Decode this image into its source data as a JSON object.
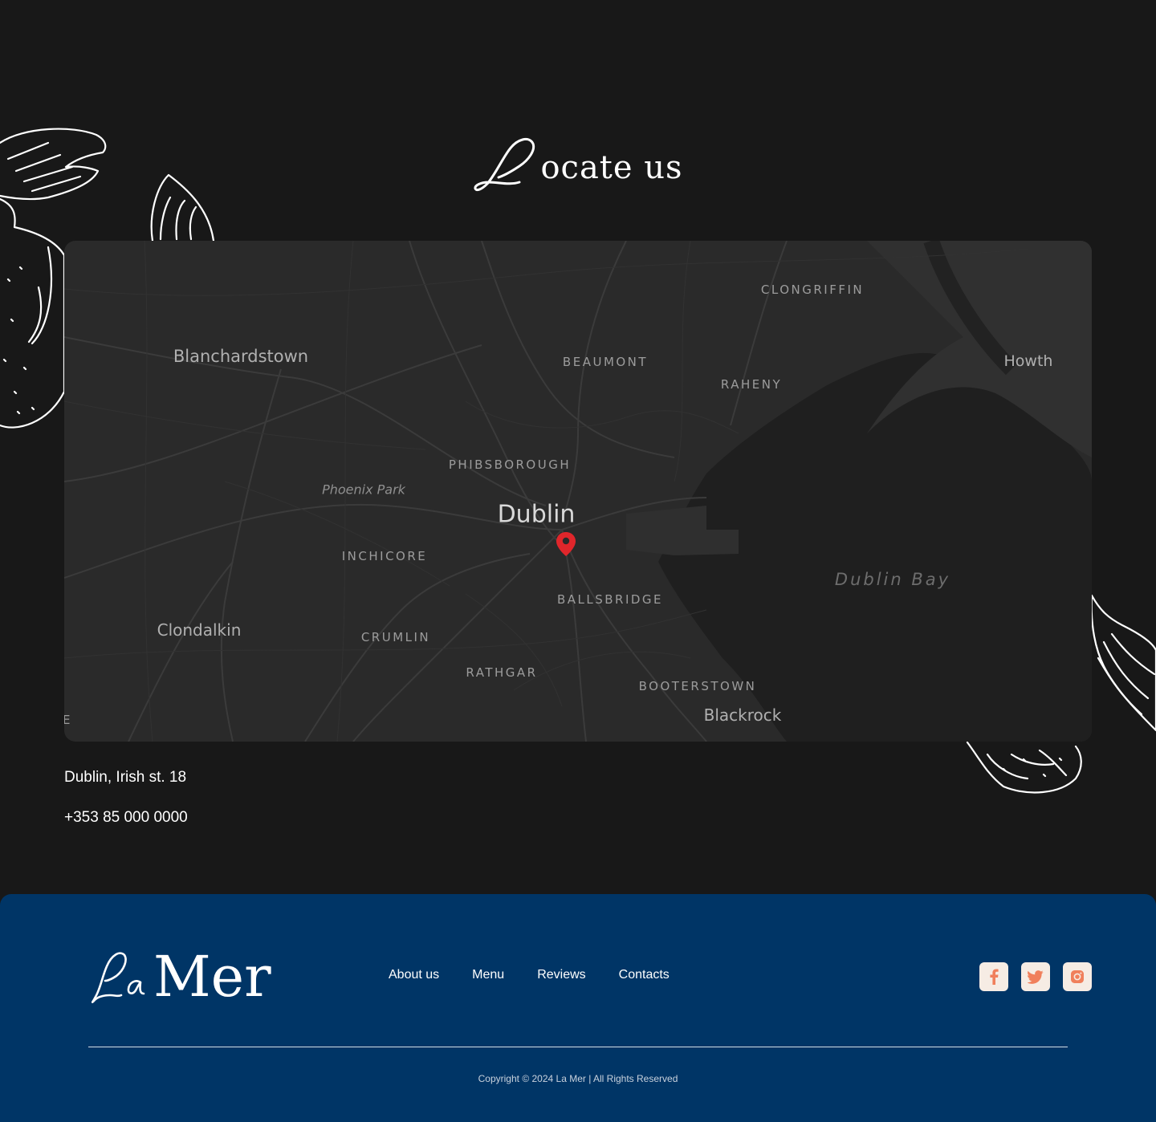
{
  "section": {
    "title_initial": "L",
    "title_rest": "ocate us"
  },
  "map": {
    "labels": {
      "clongriffin": "CLONGRIFFIN",
      "howth": "Howth",
      "blanchardstown": "Blanchardstown",
      "beaumont": "BEAUMONT",
      "raheny": "RAHENY",
      "phibsborough": "PHIBSBOROUGH",
      "phoenix_park": "Phoenix Park",
      "dublin": "Dublin",
      "inchicore": "INCHICORE",
      "ballsbridge": "BALLSBRIDGE",
      "dublin_bay": "Dublin Bay",
      "clondalkin": "Clondalkin",
      "crumlin": "CRUMLIN",
      "rathgar": "RATHGAR",
      "booterstown": "BOOTERSTOWN",
      "blackrock": "Blackrock",
      "edge": "E"
    },
    "pin_color": "#e0262b"
  },
  "contact": {
    "address": "Dublin, Irish st. 18",
    "phone": "+353 85 000 0000"
  },
  "footer": {
    "logo_script": "La",
    "logo_word": "Mer",
    "nav": [
      "About us",
      "Menu",
      "Reviews",
      "Contacts"
    ],
    "socials": [
      "facebook-icon",
      "twitter-icon",
      "instagram-icon"
    ],
    "social_icon_color": "#f07f5b",
    "copyright": "Copyright © 2024 La Mer | All Rights Reserved",
    "background": "#003566"
  }
}
